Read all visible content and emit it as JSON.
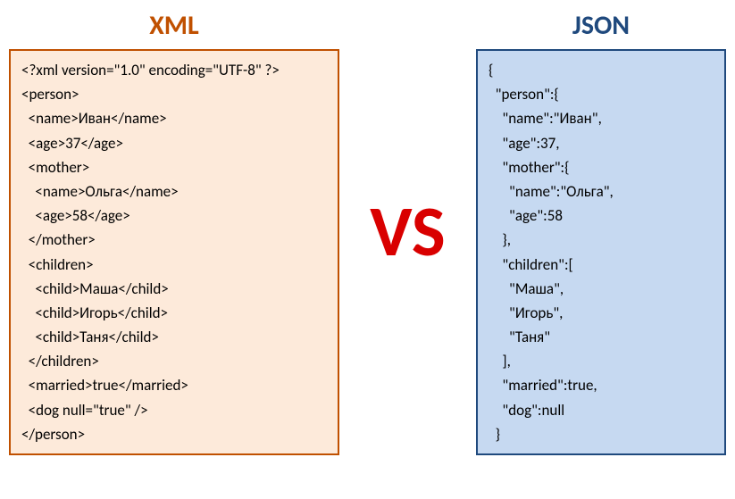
{
  "left": {
    "title": "XML",
    "code": "<?xml version=\"1.0\" encoding=\"UTF-8\" ?>\n<person>\n  <name>Иван</name>\n  <age>37</age>\n  <mother>\n    <name>Ольга</name>\n    <age>58</age>\n  </mother>\n  <children>\n    <child>Маша</child>\n    <child>Игорь</child>\n    <child>Таня</child>\n  </children>\n  <married>true</married>\n  <dog null=\"true\" />\n</person>"
  },
  "vs_label": "VS",
  "right": {
    "title": "JSON",
    "code": "{\n  \"person\":{\n    \"name\":\"Иван\",\n    \"age\":37,\n    \"mother\":{\n      \"name\":\"Ольга\",\n      \"age\":58\n    },\n    \"children\":[\n      \"Маша\",\n      \"Игорь\",\n      \"Таня\"\n    ],\n    \"married\":true,\n    \"dog\":null\n  }"
  }
}
